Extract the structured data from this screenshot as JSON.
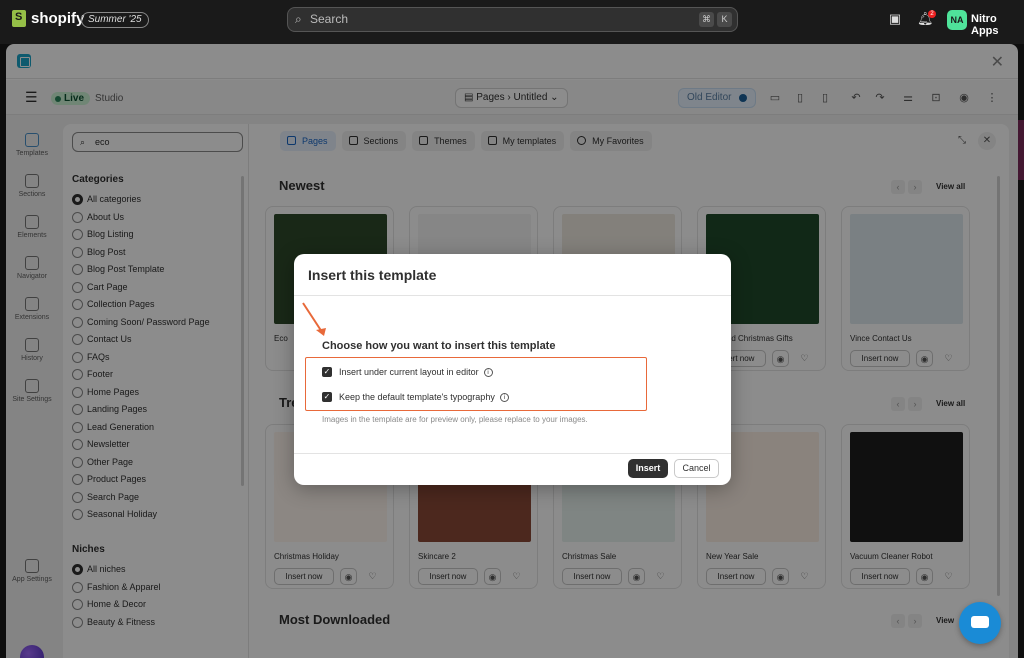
{
  "topbar": {
    "brand": "shopify",
    "edition": "Summer '25",
    "search_placeholder": "Search",
    "shortcut_keys": [
      "⌘",
      "K"
    ],
    "notification_count": "2",
    "store_initials": "NA",
    "store_name": "Nitro Apps"
  },
  "editor_bar": {
    "status": "Live",
    "mode": "Studio",
    "breadcrumb": [
      "Pages",
      "Untitled"
    ],
    "old_editor_label": "Old Editor"
  },
  "rail": {
    "items": [
      "Templates",
      "Sections",
      "Elements",
      "Navigator",
      "Extensions",
      "History",
      "Site Settings"
    ],
    "bottom_item": "App Settings"
  },
  "left_panel": {
    "search_value": "eco",
    "categories_heading": "Categories",
    "categories": [
      "All categories",
      "About Us",
      "Blog Listing",
      "Blog Post",
      "Blog Post Template",
      "Cart Page",
      "Collection Pages",
      "Coming Soon/ Password Page",
      "Contact Us",
      "FAQs",
      "Footer",
      "Home Pages",
      "Landing Pages",
      "Lead Generation",
      "Newsletter",
      "Other Page",
      "Product Pages",
      "Search Page",
      "Seasonal Holiday"
    ],
    "niches_heading": "Niches",
    "niches": [
      "All niches",
      "Fashion & Apparel",
      "Home & Decor",
      "Beauty & Fitness"
    ]
  },
  "tabs": [
    "Pages",
    "Sections",
    "Themes",
    "My templates",
    "My Favorites"
  ],
  "sections": {
    "newest": {
      "title": "Newest",
      "view_all": "View all",
      "cards": [
        "Eco",
        "",
        "",
        "onalized Christmas Gifts",
        "Vince Contact Us"
      ]
    },
    "trending": {
      "title": "Tre",
      "view_all": "View all",
      "cards": [
        "Christmas Holiday",
        "Skincare 2",
        "Christmas Sale",
        "New Year Sale",
        "Vacuum Cleaner Robot"
      ]
    },
    "most_downloaded": {
      "title": "Most Downloaded",
      "view_all": "View"
    }
  },
  "card_labels": {
    "insert_now": "Insert now"
  },
  "dialog": {
    "title": "Insert this template",
    "subtitle": "Choose how you want to insert this template",
    "option1": "Insert under current layout in editor",
    "option2": "Keep the default template's typography",
    "note": "Images in the template are for preview only, please replace to your images.",
    "insert_label": "Insert",
    "cancel_label": "Cancel"
  },
  "colors": {
    "highlight": "#e8693a",
    "accent": "#1966c7",
    "live": "#29845a"
  }
}
